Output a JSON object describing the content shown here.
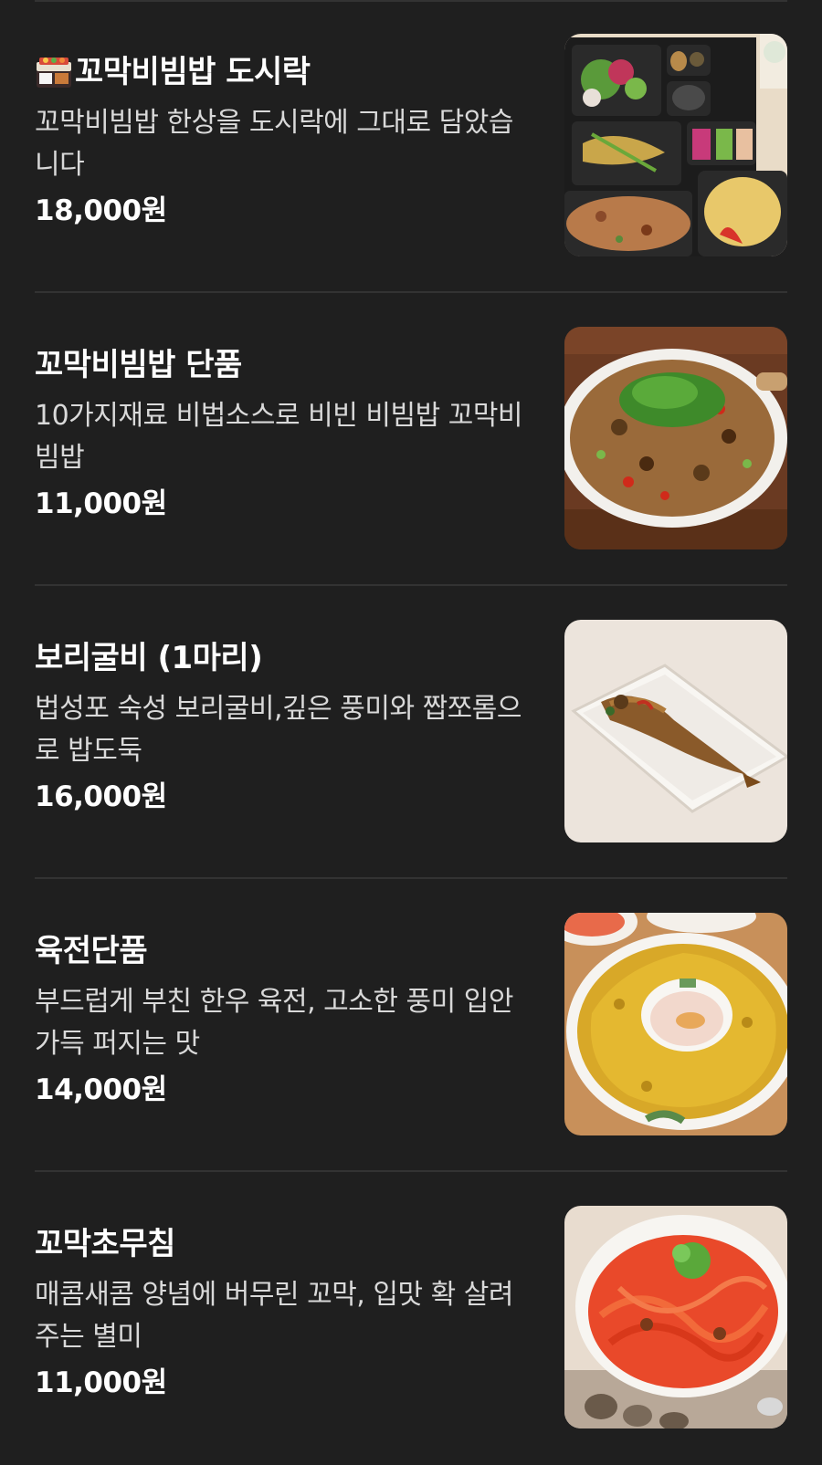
{
  "menu": {
    "items": [
      {
        "name": "꼬막비빔밥 도시락",
        "icon": "bento-box-icon",
        "description": "꼬막비빔밥 한상을 도시락에 그대로 담았습니다",
        "price": "18,000원",
        "photo": "bibimbap-bento-photo"
      },
      {
        "name": "꼬막비빔밥 단품",
        "description": "10가지재료 비법소스로 비빈 비빔밥 꼬막비빔밥",
        "price": "11,000원",
        "photo": "cockle-bibimbap-photo"
      },
      {
        "name": "보리굴비 (1마리)",
        "description": "법성포 숙성 보리굴비,깊은 풍미와 짭쪼롬으로 밥도둑",
        "price": "16,000원",
        "photo": "dried-croaker-photo"
      },
      {
        "name": "육전단품",
        "description": "부드럽게 부친 한우 육전, 고소한 풍미 입안 가득 퍼지는 맛",
        "price": "14,000원",
        "photo": "beef-jeon-photo"
      },
      {
        "name": "꼬막초무침",
        "description": "매콤새콤 양념에 버무린 꼬막, 입맛 확 살려주는 별미",
        "price": "11,000원",
        "photo": "cockle-salad-photo"
      }
    ]
  }
}
